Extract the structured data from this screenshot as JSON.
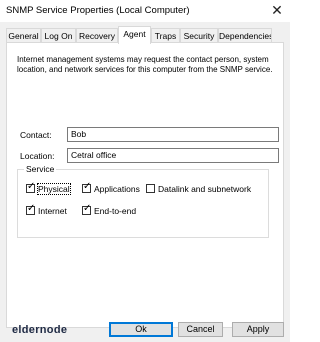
{
  "window": {
    "title": "SNMP Service Properties (Local Computer)",
    "close_glyph": "✕"
  },
  "tabs": [
    "General",
    "Log On",
    "Recovery",
    "Agent",
    "Traps",
    "Security",
    "Dependencies"
  ],
  "agent": {
    "description": "Internet management systems may request the contact person, system location, and network services for this computer from the SNMP service.",
    "contact": {
      "label": "Contact:",
      "value": "Bob"
    },
    "location": {
      "label": "Location:",
      "value": "Cetral office"
    },
    "service": {
      "title": "Service",
      "physical": {
        "label": "Physical",
        "checked": true
      },
      "applications": {
        "label": "Applications",
        "checked": true
      },
      "datalink": {
        "label": "Datalink and subnetwork",
        "checked": false
      },
      "internet": {
        "label": "Internet",
        "checked": true
      },
      "endtoend": {
        "label": "End-to-end",
        "checked": true
      }
    }
  },
  "buttons": {
    "ok": "Ok",
    "cancel": "Cancel",
    "apply": "Apply"
  },
  "watermark": "eldernode"
}
